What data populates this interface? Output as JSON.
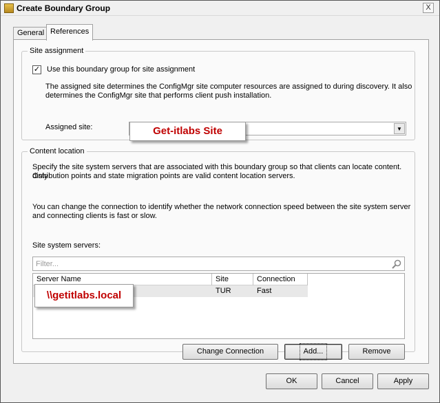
{
  "window": {
    "title": "Create Boundary Group",
    "close_glyph": "X"
  },
  "tabs": [
    {
      "label": "General",
      "active": false
    },
    {
      "label": "References",
      "active": true
    }
  ],
  "site_assignment": {
    "group_label": "Site assignment",
    "checkbox_label": "Use this boundary group for site assignment",
    "checkbox_checked": true,
    "checkbox_glyph": "✓",
    "description_line1": "The assigned site determines the ConfigMgr site computer resources are assigned to during discovery. It also",
    "description_line2": "determines the ConfigMgr site that performs client push installation.",
    "assigned_site_label": "Assigned site:",
    "assigned_site_value": "Get-itlabs Site",
    "dropdown_glyph": "▼"
  },
  "content_location": {
    "group_label": "Content location",
    "description1_line1": "Specify the site system servers that are associated with this boundary group so that clients can locate content. Only",
    "description1_line2": "distribution points and state migration points are valid content location servers.",
    "description2_line1": "You can change the connection to identify whether the network connection speed between the site system server",
    "description2_line2": "and connecting clients is fast or slow.",
    "servers_label": "Site system servers:",
    "filter_placeholder": "Filter...",
    "columns": [
      "Server Name",
      "Site",
      "Connection"
    ],
    "rows": [
      {
        "server": "\\\\getitlabs.local",
        "site": "TUR",
        "connection": "Fast"
      }
    ],
    "buttons": {
      "change_connection": "Change Connection",
      "add": "Add...",
      "remove": "Remove"
    }
  },
  "footer": {
    "ok": "OK",
    "cancel": "Cancel",
    "apply": "Apply"
  },
  "colors": {
    "callout_text": "#c00000",
    "dialog_bg": "#f0f0f0"
  },
  "icons": [
    "app-icon",
    "close-icon",
    "checkbox-check-icon",
    "dropdown-arrow-icon",
    "search-icon"
  ]
}
